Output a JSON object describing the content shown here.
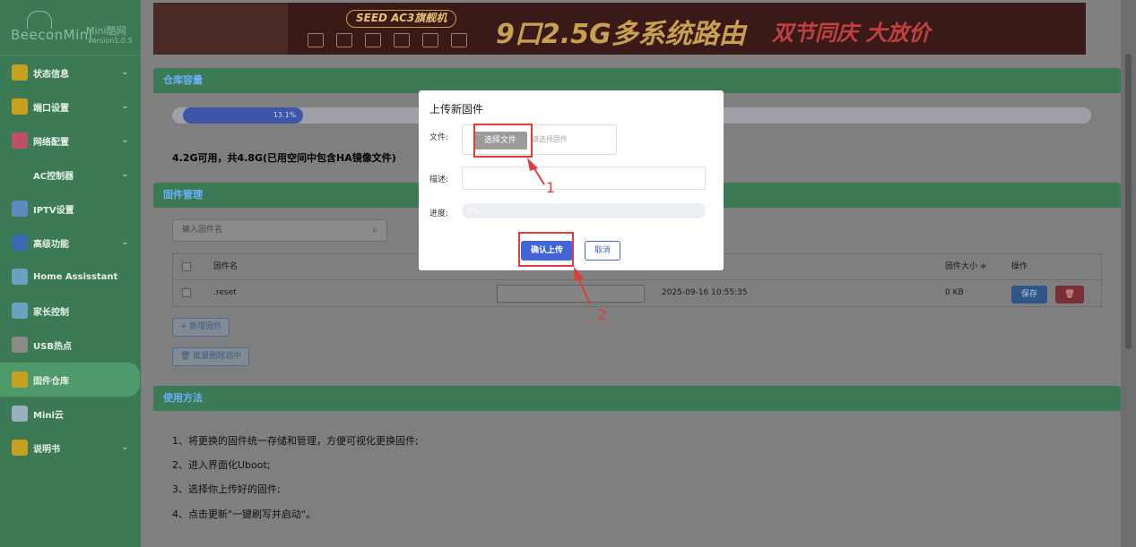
{
  "sidebar": {
    "logo": {
      "brand": "BeeconMini",
      "mini": "Mini酷网",
      "version": "version1.0.5"
    },
    "items": [
      {
        "label": "状态信息",
        "icon": "sun-icon",
        "color": "#c8a020",
        "chevron": true
      },
      {
        "label": "端口设置",
        "icon": "gear-icon",
        "color": "#c8a020",
        "chevron": true
      },
      {
        "label": "网络配置",
        "icon": "network-icon",
        "color": "#c0506a",
        "chevron": true
      },
      {
        "label": "AC控制器",
        "icon": "ac-icon",
        "color": "#3c7a55",
        "chevron": true
      },
      {
        "label": "IPTV设置",
        "icon": "grid-icon",
        "color": "#5a8ac0",
        "chevron": false
      },
      {
        "label": "高级功能",
        "icon": "sliders-icon",
        "color": "#3a6ab0",
        "chevron": true
      },
      {
        "label": "Home Assisstant",
        "icon": "home-icon",
        "color": "#6aa0c0",
        "chevron": false
      },
      {
        "label": "家长控制",
        "icon": "family-icon",
        "color": "#6aa0c0",
        "chevron": false
      },
      {
        "label": "USB热点",
        "icon": "usb-icon",
        "color": "#8a8a8a",
        "chevron": false
      },
      {
        "label": "固件仓库",
        "icon": "warehouse-icon",
        "color": "#c8a020",
        "chevron": false,
        "active": true
      },
      {
        "label": "Mini云",
        "icon": "cloud-icon",
        "color": "#9ab0c0",
        "chevron": false
      },
      {
        "label": "说明书",
        "icon": "book-icon",
        "color": "#c8a020",
        "chevron": true
      }
    ]
  },
  "banner": {
    "seed": "SEED AC3旗舰机",
    "headline": "9口2.5G多系统路由",
    "promo": "双节同庆 大放价"
  },
  "storage": {
    "title": "仓库容量",
    "percent_label": "13.1%",
    "percent": 13.1,
    "usage_text": "4.2G可用，共4.8G(已用空间中包含HA镜像文件)"
  },
  "firmware": {
    "title": "固件管理",
    "search_placeholder": "输入固件名",
    "columns": {
      "name": "固件名",
      "size": "固件大小 ≑",
      "action": "操作"
    },
    "rows": [
      {
        "name": ".reset",
        "date": "2025-09-16 10:55:35",
        "size": "0 KB",
        "save": "保存",
        "delete": "🗑"
      }
    ],
    "add_button": "+ 新增固件",
    "batch_delete_button": "🗑 批量删除选中"
  },
  "usage": {
    "title": "使用方法",
    "steps": [
      "1、将更换的固件统一存储和管理，方便可视化更换固件;",
      "2、进入界面化Uboot;",
      "3、选择你上传好的固件;",
      "4、点击更新\"一键刷写并启动\"。"
    ]
  },
  "modal": {
    "title": "上传新固件",
    "file_label": "文件:",
    "file_button": "选择文件",
    "file_placeholder": "请选择固件",
    "desc_label": "描述:",
    "progress_label": "进度:",
    "progress_text": "0%",
    "progress": 0,
    "confirm": "确认上传",
    "cancel": "取消"
  },
  "annotations": {
    "one": "1",
    "two": "2",
    "color": "#e23b3b"
  }
}
